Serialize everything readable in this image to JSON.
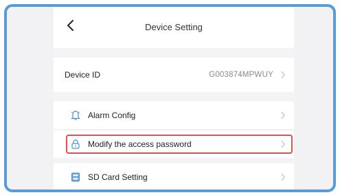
{
  "header": {
    "title": "Device Setting"
  },
  "device_id": {
    "label": "Device ID",
    "value": "G003874MPWUY"
  },
  "menu": {
    "alarm_config": {
      "label": "Alarm Config",
      "icon": "alarm-icon"
    },
    "modify_password": {
      "label": "Modify the access password",
      "icon": "lock-icon"
    },
    "sd_card": {
      "label": "SD Card Setting",
      "icon": "sd-card-icon"
    }
  },
  "colors": {
    "frame_border": "#5b9bd5",
    "highlight": "#d9534f",
    "icon_blue": "#4a90d9"
  }
}
